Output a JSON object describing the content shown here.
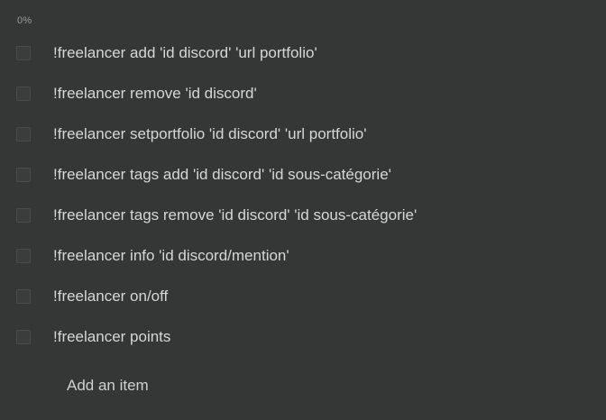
{
  "checklist": {
    "progress_text": "0%",
    "progress": 0,
    "items": [
      {
        "label": "!freelancer add 'id discord' 'url portfolio'",
        "checked": false
      },
      {
        "label": "!freelancer remove 'id discord'",
        "checked": false
      },
      {
        "label": "!freelancer setportfolio 'id discord' 'url portfolio'",
        "checked": false
      },
      {
        "label": "!freelancer tags add 'id discord' 'id sous-catégorie'",
        "checked": false
      },
      {
        "label": "!freelancer tags remove 'id discord' 'id sous-catégorie'",
        "checked": false
      },
      {
        "label": "!freelancer info 'id discord/mention'",
        "checked": false
      },
      {
        "label": "!freelancer on/off",
        "checked": false
      },
      {
        "label": "!freelancer points",
        "checked": false
      }
    ],
    "add_item_label": "Add an item"
  },
  "colors": {
    "background": "#353737",
    "text": "#d6d6d6",
    "muted": "#9a9a9a",
    "checkbox_border": "#4a4c4c"
  }
}
